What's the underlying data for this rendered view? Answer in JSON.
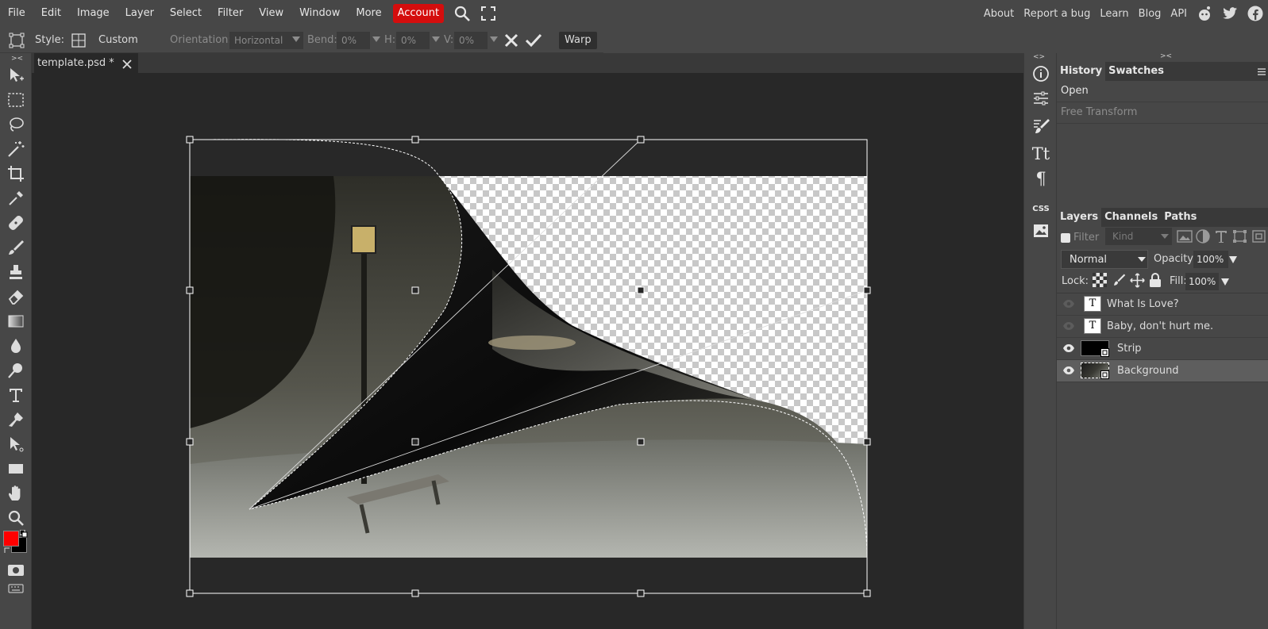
{
  "menu": {
    "items": [
      "File",
      "Edit",
      "Image",
      "Layer",
      "Select",
      "Filter",
      "View",
      "Window",
      "More"
    ],
    "account": "Account",
    "right_links": [
      "About",
      "Report a bug",
      "Learn",
      "Blog",
      "API"
    ],
    "social_icons": [
      "reddit-icon",
      "twitter-icon",
      "facebook-icon"
    ]
  },
  "options": {
    "style_label": "Style:",
    "style_value": "Custom",
    "orientation_label": "Orientation:",
    "orientation_value": "Horizontal",
    "bend_label": "Bend:",
    "bend_value": "0%",
    "h_label": "H:",
    "h_value": "0%",
    "v_label": "V:",
    "v_value": "0%",
    "warp_label": "Warp"
  },
  "document": {
    "tab_title": "template.psd *"
  },
  "tools": [
    "move-tool-icon",
    "marquee-tool-icon",
    "lasso-tool-icon",
    "magic-wand-icon",
    "crop-tool-icon",
    "eyedropper-icon",
    "healing-brush-icon",
    "brush-tool-icon",
    "clone-stamp-icon",
    "eraser-icon",
    "gradient-tool-icon",
    "blur-tool-icon",
    "dodge-tool-icon",
    "type-tool-icon",
    "pen-tool-icon",
    "path-select-icon",
    "shape-tool-icon",
    "hand-tool-icon",
    "zoom-tool-icon"
  ],
  "colors": {
    "foreground": "#ff0000",
    "background": "#000000",
    "accent": "#d40d0d"
  },
  "history": {
    "tabs": [
      "History",
      "Swatches"
    ],
    "items": [
      "Open",
      "Free Transform"
    ]
  },
  "layers_panel": {
    "tabs": [
      "Layers",
      "Channels",
      "Paths"
    ],
    "filter_label": "Filter",
    "kind_placeholder": "Kind",
    "blend_mode": "Normal",
    "opacity_label": "Opacity:",
    "opacity_value": "100%",
    "lock_label": "Lock:",
    "fill_label": "Fill:",
    "fill_value": "100%",
    "layers": [
      {
        "name": "What Is Love?",
        "type": "text",
        "visible": false
      },
      {
        "name": "Baby, don't hurt me.",
        "type": "text",
        "visible": false
      },
      {
        "name": "Strip",
        "type": "smart",
        "visible": true
      },
      {
        "name": "Background",
        "type": "smart",
        "visible": true,
        "selected": true
      }
    ]
  }
}
